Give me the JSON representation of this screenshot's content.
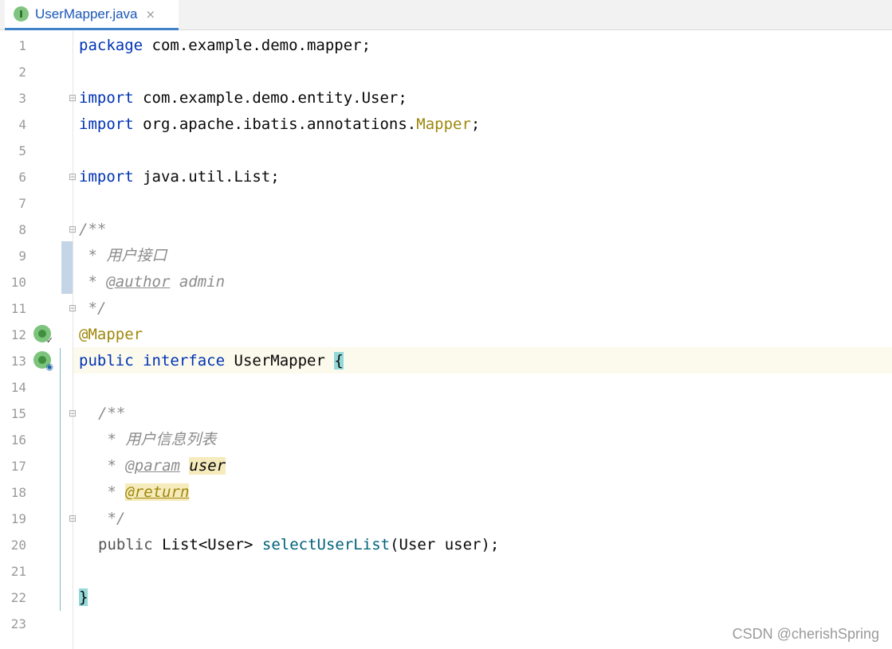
{
  "tab": {
    "label": "UserMapper.java",
    "icon": "interface-icon",
    "icon_letter": "I",
    "close": "×"
  },
  "line_numbers": [
    "1",
    "2",
    "3",
    "4",
    "5",
    "6",
    "7",
    "8",
    "9",
    "10",
    "11",
    "12",
    "13",
    "14",
    "15",
    "16",
    "17",
    "18",
    "19",
    "20",
    "21",
    "22",
    "23"
  ],
  "code": {
    "l1_kw": "package",
    "l1_rest": " com.example.demo.mapper;",
    "l3_kw": "import",
    "l3_rest": " com.example.demo.entity.User;",
    "l4_kw": "import",
    "l4_rest": " org.apache.ibatis.annotations.",
    "l4_ann": "Mapper",
    "l4_end": ";",
    "l6_kw": "import",
    "l6_rest": " java.util.List;",
    "l8": "/**",
    "l9": " * 用户接口",
    "l10_pre": " * ",
    "l10_tag": "@author",
    "l10_rest": " admin",
    "l11": " */",
    "l12": "@Mapper",
    "l13_kw1": "public",
    "l13_kw2": "interface",
    "l13_name": "UserMapper",
    "l13_brace": "{",
    "l15": "/**",
    "l16": " * 用户信息列表",
    "l17_pre": " * ",
    "l17_tag": "@param",
    "l17_param": "user",
    "l18_pre": " * ",
    "l18_tag": "@return",
    "l19": " */",
    "l20_kw": "public",
    "l20_type": " List<User> ",
    "l20_fn": "selectUserList",
    "l20_args": "(User user);",
    "l22": "}"
  },
  "watermark": "CSDN @cherishSpring",
  "colors": {
    "keyword": "#0033b3",
    "annotation": "#9e880d",
    "method": "#00627a",
    "comment": "#8c8c8c",
    "tab_accent": "#4083c9"
  }
}
